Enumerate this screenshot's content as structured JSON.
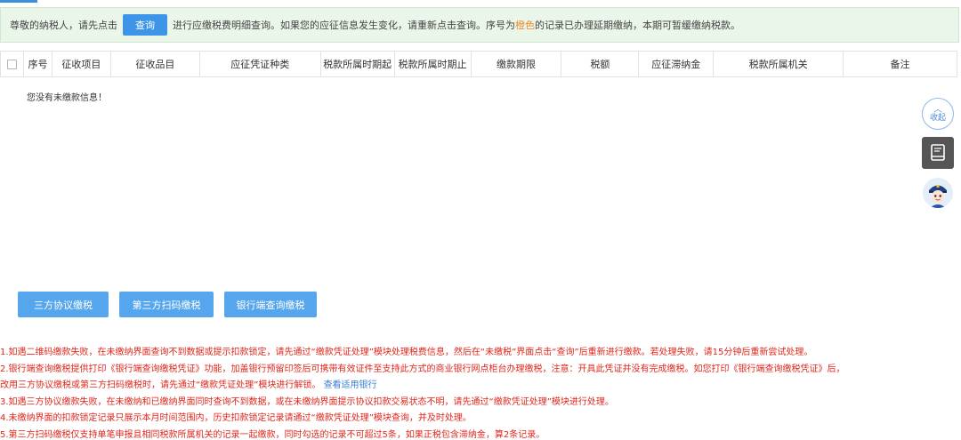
{
  "notice": {
    "prefix": "尊敬的纳税人，请先点击",
    "query_button": "查询",
    "middle": "进行应缴税费明细查询。如果您的应征信息发生变化，请重新点击查询。序号为",
    "highlight": "橙色",
    "suffix": "的记录已办理延期缴纳，本期可暂缓缴纳税款。",
    "highlight_color": "#f08a24"
  },
  "table": {
    "columns": [
      "序号",
      "征收项目",
      "征收品目",
      "应征凭证种类",
      "税款所属时期起",
      "税款所属时期止",
      "缴款期限",
      "税额",
      "应征滞纳金",
      "税款所属机关",
      "备注"
    ],
    "empty_message": "您没有未缴款信息！"
  },
  "side_tools": {
    "collapse_label": "收起",
    "collapse_chevron": "︿",
    "book_icon": "book-icon",
    "assistant_icon": "police-avatar-icon"
  },
  "actions": [
    "三方协议缴税",
    "第三方扫码缴税",
    "银行端查询缴税"
  ],
  "notes": {
    "n1": "1.如遇二维码缴款失败，在未缴纳界面查询不到数据或提示扣款锁定，请先通过“缴款凭证处理”模块处理税费信息，然后在“未缴税”界面点击“查询”后重新进行缴款。若处理失败，请15分钟后重新尝试处理。",
    "n2a": "2.银行端查询缴税提供打印《银行端查询缴税凭证》功能，加盖银行预留印签后可携带有效证件至支持此方式的商业银行网点柜台办理缴税，注意：开具此凭证并没有完成缴税。如您打印《银行端查询缴税凭证》后，",
    "n2b": "改用三方协议缴税或第三方扫码缴税时，请先通过“缴款凭证处理”模块进行解锁。",
    "n2_link": "查看适用银行",
    "n3": "3.如遇三方协议缴款失败，在未缴纳和已缴纳界面同时查询不到数据，或在未缴纳界面提示协议扣款交易状态不明，请先通过“缴款凭证处理”模块进行处理。",
    "n4": "4.未缴纳界面的扣款锁定记录只展示本月时间范围内，历史扣款锁定记录请通过“缴款凭证处理”模块查询，并及时处理。",
    "n5": "5.第三方扫码缴税仅支持单笔申报且相同税款所属机关的记录一起缴款，同时勾选的记录不可超过5条，如果正税包含滞纳金，算2条记录。"
  },
  "colors": {
    "accent": "#3e95e8",
    "notice_bg": "#eaf6ea",
    "note_red": "#e0261b",
    "link_blue": "#3a7fd5"
  }
}
